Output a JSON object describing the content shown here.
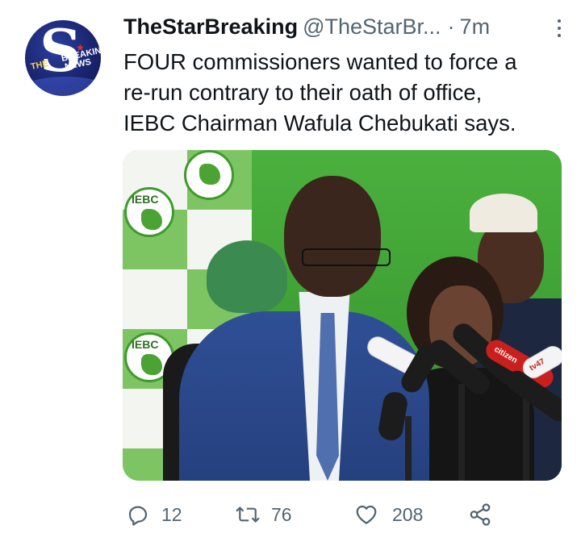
{
  "tweet": {
    "author_name": "TheStarBreaking",
    "author_handle": "@TheStarBr...",
    "separator": "·",
    "time_ago": "7m",
    "text_lines": [
      "FOUR commissioners wanted to force a",
      "re-run contrary to their oath of office,",
      "IEBC Chairman Wafula Chebukati says."
    ],
    "avatar": {
      "letter": "S",
      "the_text": "THE",
      "breaking_text": "BREAKING",
      "news_text": "NEWS"
    },
    "photo": {
      "banner_logo_text_1": "IEBC",
      "banner_logo_text_2": "IEBC",
      "mic_label_1": "citizen",
      "mic_label_2": "tv47"
    }
  },
  "actions": {
    "reply_icon": "reply-icon",
    "reply_count": "12",
    "retweet_icon": "retweet-icon",
    "retweet_count": "76",
    "like_icon": "heart-icon",
    "like_count": "208",
    "share_icon": "share-icon"
  },
  "colors": {
    "text_primary": "#0f1419",
    "text_secondary": "#536471",
    "iebc_green": "#3ea23a"
  }
}
